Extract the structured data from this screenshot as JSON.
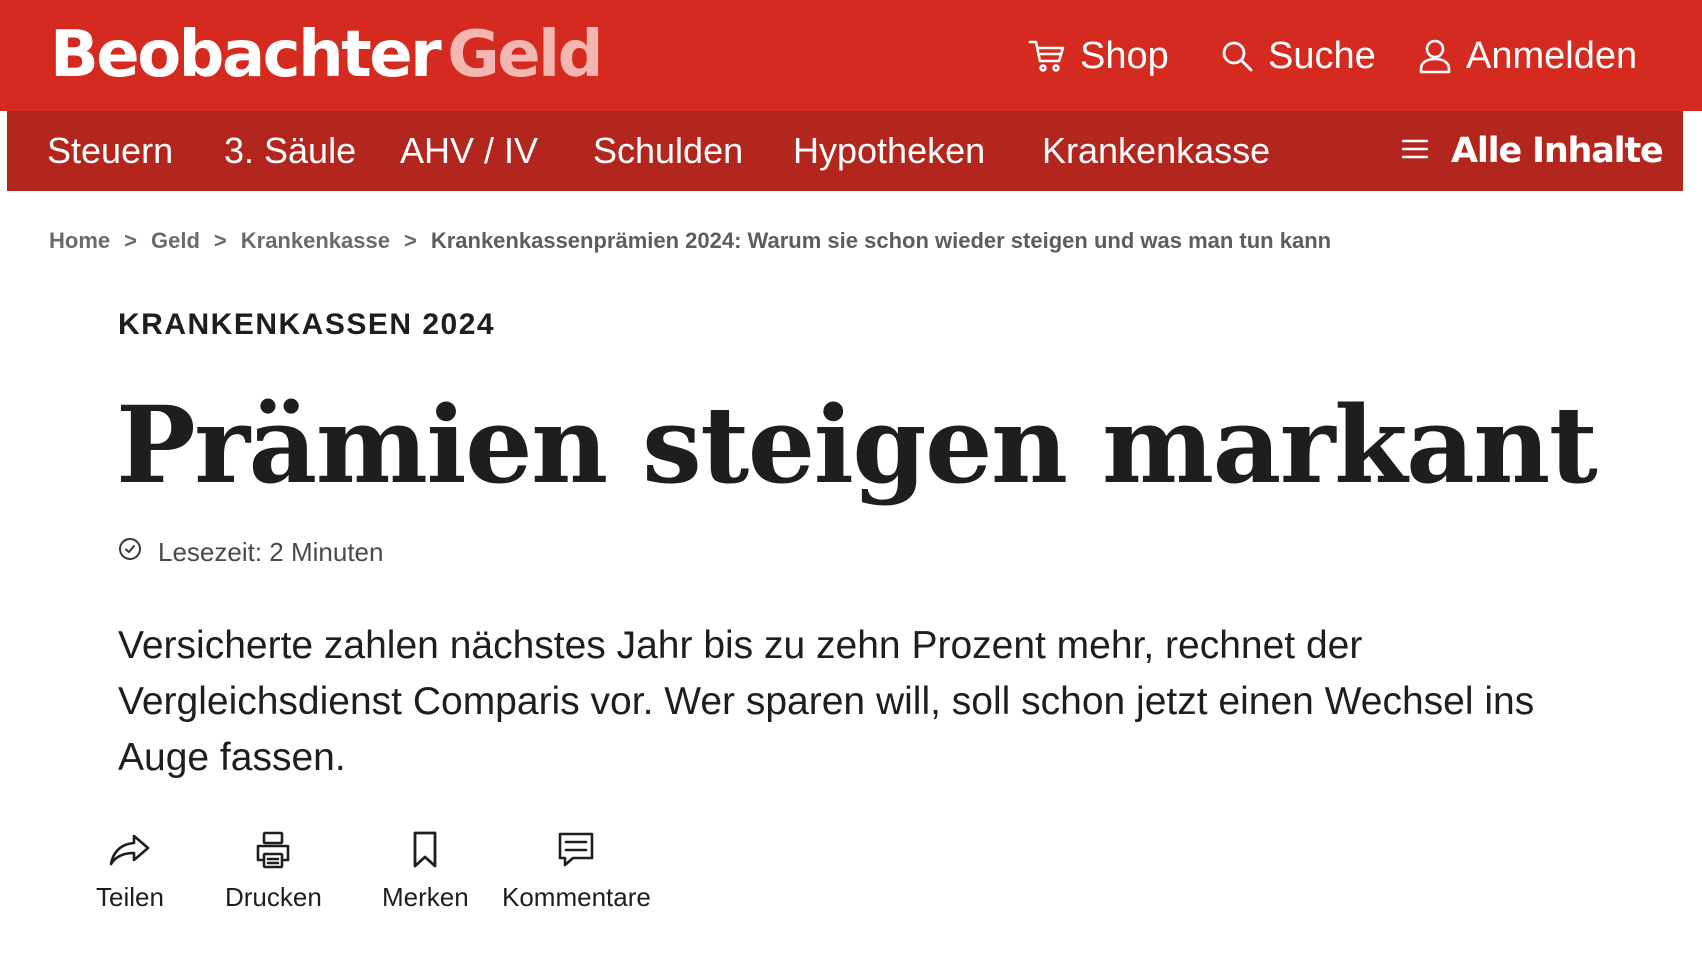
{
  "header": {
    "logo_brand": "Beobachter",
    "logo_section": "Geld",
    "shop_label": "Shop",
    "search_label": "Suche",
    "login_label": "Anmelden"
  },
  "nav": {
    "items": [
      "Steuern",
      "3. Säule",
      "AHV / IV",
      "Schulden",
      "Hypotheken",
      "Krankenkasse"
    ],
    "all_content_label": "Alle Inhalte"
  },
  "breadcrumb": {
    "separator": ">",
    "items": [
      "Home",
      "Geld",
      "Krankenkasse"
    ],
    "current": "Krankenkassenprämien 2024: Warum sie schon wieder steigen und was man tun kann"
  },
  "article": {
    "kicker": "KRANKENKASSEN 2024",
    "headline": "Prämien steigen markant",
    "reading_time": "Lesezeit: 2 Minuten",
    "lead": "Versicherte zahlen nächstes Jahr bis zu zehn Prozent mehr, rechnet der Vergleichsdienst Comparis vor. Wer sparen will, soll schon jetzt einen Wechsel ins Auge fassen."
  },
  "actions": {
    "share_label": "Teilen",
    "print_label": "Drucken",
    "save_label": "Merken",
    "comments_label": "Kommentare"
  },
  "colors": {
    "header_red": "#d42a1f",
    "nav_red": "#b3261d",
    "logo_section_pink": "#f3b6b0",
    "text_dark": "#1e1e1e",
    "breadcrumb_grey": "#6b6b6b"
  },
  "icons": [
    "cart-icon",
    "search-icon",
    "user-icon",
    "menu-icon",
    "clock-icon",
    "share-icon",
    "printer-icon",
    "bookmark-icon",
    "comment-icon"
  ]
}
